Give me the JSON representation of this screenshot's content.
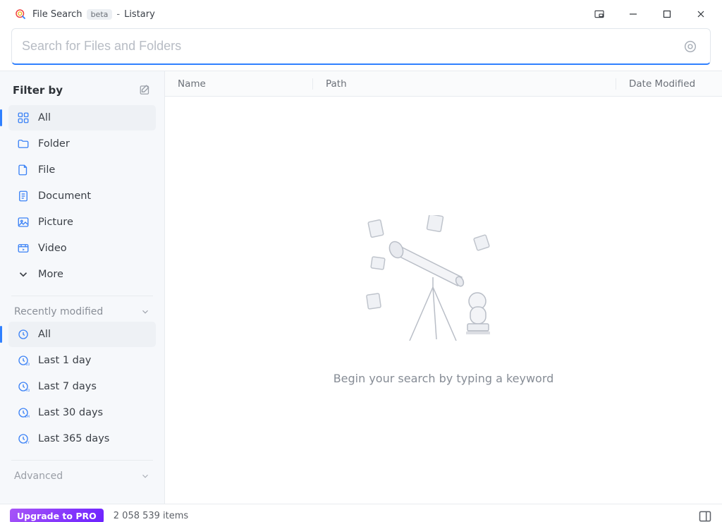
{
  "window": {
    "title": "File Search",
    "badge": "beta",
    "app_name": "Listary"
  },
  "search": {
    "placeholder": "Search for Files and Folders",
    "value": ""
  },
  "sidebar": {
    "title": "Filter by",
    "filters": [
      {
        "label": "All"
      },
      {
        "label": "Folder"
      },
      {
        "label": "File"
      },
      {
        "label": "Document"
      },
      {
        "label": "Picture"
      },
      {
        "label": "Video"
      },
      {
        "label": "More"
      }
    ],
    "recent_title": "Recently modified",
    "recent": [
      {
        "label": "All"
      },
      {
        "label": "Last 1 day"
      },
      {
        "label": "Last 7 days"
      },
      {
        "label": "Last 30 days"
      },
      {
        "label": "Last 365 days"
      }
    ],
    "advanced_title": "Advanced"
  },
  "table": {
    "columns": {
      "name": "Name",
      "path": "Path",
      "date": "Date Modified"
    },
    "empty_hint": "Begin your search by typing a keyword"
  },
  "status": {
    "pro_label": "Upgrade to PRO",
    "item_count": "2 058 539 items"
  }
}
